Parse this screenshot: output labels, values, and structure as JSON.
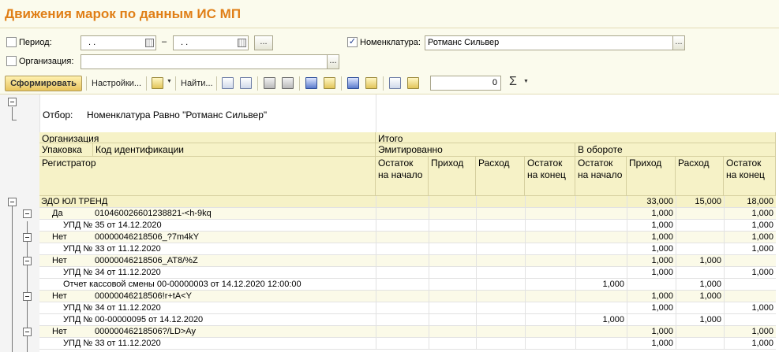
{
  "title": "Движения марок по данным ИС МП",
  "filters": {
    "period": {
      "label": "Период:",
      "checked": false,
      "from": ". .",
      "to": ". .",
      "dash": "–",
      "dots": "..."
    },
    "nomenclature": {
      "label": "Номенклатура:",
      "checked": true,
      "value": "Ротманс Сильвер",
      "dots": "..."
    },
    "organization": {
      "label": "Организация:",
      "checked": false,
      "value": "",
      "dots": "..."
    }
  },
  "toolbar": {
    "generate_label": "Сформировать",
    "settings_label": "Настройки...",
    "find_label": "Найти...",
    "counter_value": "0",
    "sigma": "Σ"
  },
  "report": {
    "filter_caption": "Отбор:",
    "filter_text": "Номенклатура Равно \"Ротманс Сильвер\"",
    "header": {
      "organization": "Организация",
      "itogo": "Итого",
      "packaging": "Упаковка",
      "code": "Код идентификации",
      "emitted": "Эмитированно",
      "in_circulation": "В обороте",
      "registrar": "Регистратор",
      "cols": [
        "Остаток на начало",
        "Приход",
        "Расход",
        "Остаток на конец",
        "Остаток на начало",
        "Приход",
        "Расход",
        "Остаток на конец"
      ]
    },
    "rows": [
      {
        "level": 1,
        "text": "ЭДО ЮЛ ТРЕНД",
        "c5": "33,000",
        "c6": "15,000",
        "c7": "18,000"
      },
      {
        "level": 2,
        "text": "Да",
        "code": "010460026601238821-<h-9kq",
        "c5": "1,000",
        "c7": "1,000"
      },
      {
        "level": 3,
        "text": "УПД № 35 от 14.12.2020",
        "c5": "1,000",
        "c7": "1,000"
      },
      {
        "level": 2,
        "text": "Нет",
        "code": "00000046218506_?7m4kY",
        "c5": "1,000",
        "c7": "1,000"
      },
      {
        "level": 3,
        "text": "УПД № 33 от 11.12.2020",
        "c5": "1,000",
        "c7": "1,000"
      },
      {
        "level": 2,
        "text": "Нет",
        "code": "00000046218506_AT8/%Z",
        "c5": "1,000",
        "c6": "1,000"
      },
      {
        "level": 3,
        "text": "УПД № 34 от 11.12.2020",
        "c5": "1,000",
        "c7": "1,000"
      },
      {
        "level": 3,
        "text": "Отчет кассовой смены 00-00000003 от 14.12.2020 12:00:00",
        "c4": "1,000",
        "c6": "1,000"
      },
      {
        "level": 2,
        "text": "Нет",
        "code": "00000046218506!r+tA<Y",
        "c5": "1,000",
        "c6": "1,000"
      },
      {
        "level": 3,
        "text": "УПД № 34 от 11.12.2020",
        "c5": "1,000",
        "c7": "1,000"
      },
      {
        "level": 3,
        "text": "УПД № 00-00000095 от 14.12.2020",
        "c4": "1,000",
        "c6": "1,000"
      },
      {
        "level": 2,
        "text": "Нет",
        "code": "00000046218506?/LD>Ay",
        "c5": "1,000",
        "c7": "1,000"
      },
      {
        "level": 3,
        "text": "УПД № 33 от 11.12.2020",
        "c5": "1,000",
        "c7": "1,000"
      }
    ]
  }
}
